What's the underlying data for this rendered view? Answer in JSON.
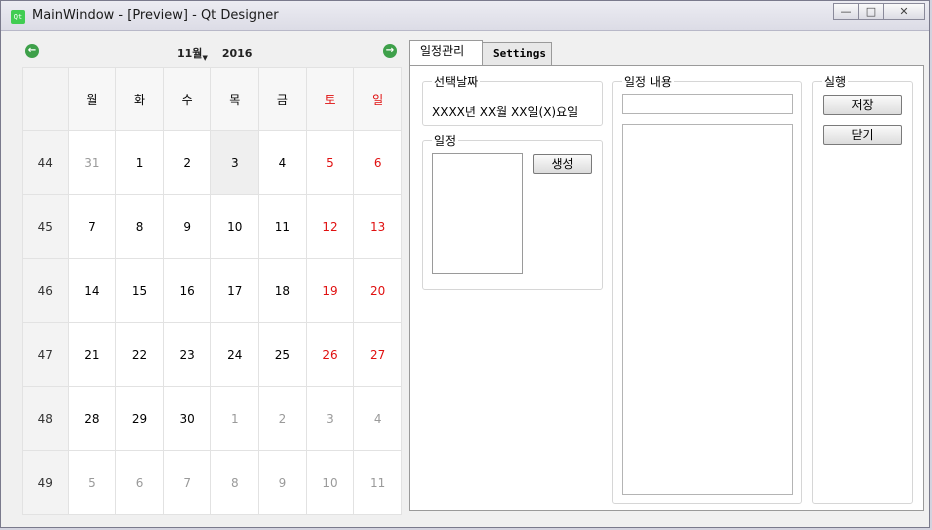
{
  "window": {
    "title": "MainWindow - [Preview] - Qt Designer",
    "app_icon_text": "Qt",
    "minimize_glyph": "—",
    "maximize_glyph": "□",
    "close_glyph": "✕"
  },
  "calendar": {
    "prev_icon": "arrow-left-icon",
    "next_icon": "arrow-right-icon",
    "prev_glyph": "←",
    "next_glyph": "→",
    "month": "11월",
    "month_caret": "▼",
    "year": "2016",
    "weekday_headers": [
      "월",
      "화",
      "수",
      "목",
      "금",
      "토",
      "일"
    ],
    "weeks": [
      {
        "number": "44",
        "days": [
          "31",
          "1",
          "2",
          "3",
          "4",
          "5",
          "6"
        ]
      },
      {
        "number": "45",
        "days": [
          "7",
          "8",
          "9",
          "10",
          "11",
          "12",
          "13"
        ]
      },
      {
        "number": "46",
        "days": [
          "14",
          "15",
          "16",
          "17",
          "18",
          "19",
          "20"
        ]
      },
      {
        "number": "47",
        "days": [
          "21",
          "22",
          "23",
          "24",
          "25",
          "26",
          "27"
        ]
      },
      {
        "number": "48",
        "days": [
          "28",
          "29",
          "30",
          "1",
          "2",
          "3",
          "4"
        ]
      },
      {
        "number": "49",
        "days": [
          "5",
          "6",
          "7",
          "8",
          "9",
          "10",
          "11"
        ]
      }
    ],
    "selected_day": "3",
    "weekend_color": "#e01010",
    "other_month_color": "#9a9a9a"
  },
  "tabs": {
    "schedule_label": "일정관리",
    "settings_label": "Settings"
  },
  "schedule": {
    "selected_date_title": "선택날짜",
    "selected_date_value": "XXXX년 XX월 XX일(X)요일",
    "list_title": "일정",
    "create_button": "생성",
    "content_title": "일정 내용",
    "content_title_value": "",
    "content_body": "",
    "actions_title": "실행",
    "save_button": "저장",
    "close_button": "닫기"
  }
}
